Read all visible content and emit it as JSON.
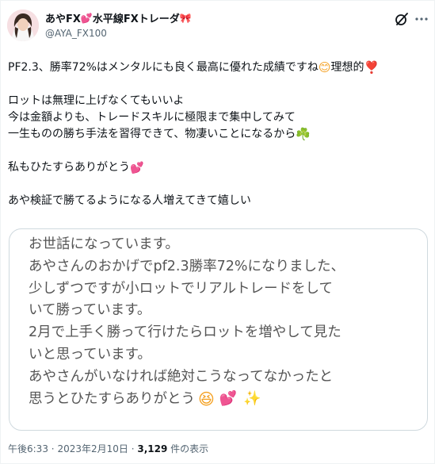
{
  "post": {
    "display_name": "あやFX",
    "display_name_suffix": "水平線FXトレーダ",
    "handle": "@AYA_FX100",
    "text_lines": [
      "PF2.3、勝率72%はメンタルにも良く最高に優れた成績ですね",
      "理想的",
      "ロットは無理に上げなくてもいいよ",
      "今は金額よりも、トレードスキルに極限まで集中してみて",
      "一生ものの勝ち手法を習得できて、物凄いことになるから",
      "私もひたすらありがとう",
      "あや検証で勝てるようになる人増えてきて嬉しい"
    ],
    "emoji": {
      "name_heart": "💕",
      "name_ribbon": "🎀",
      "smile": "😊",
      "exclamation": "❣️",
      "clover": "☘️",
      "heart": "💕"
    }
  },
  "media": {
    "lines": [
      "お世話になっています。",
      "あやさんのおかげでpf2.3勝率72%になりました、",
      "少しずつですが小ロットでリアルトレードをして",
      "いて勝っています。",
      "2月で上手く勝って行けたらロットを増やして見た",
      "いと思っています。",
      "あやさんがいなければ絶対こうなってなかったと",
      "思うとひたすらありがとう"
    ],
    "end_emoji": [
      "😆",
      "💕",
      "✨"
    ]
  },
  "meta": {
    "time": "午後6:33",
    "separator": "·",
    "date": "2023年2月10日",
    "views_count": "3,129",
    "views_label": "件の表示"
  },
  "icons": [
    "grok-icon",
    "more-options-icon"
  ],
  "colors": {
    "text": "#0f1419",
    "secondary": "#536471",
    "border": "#cfd9de"
  }
}
